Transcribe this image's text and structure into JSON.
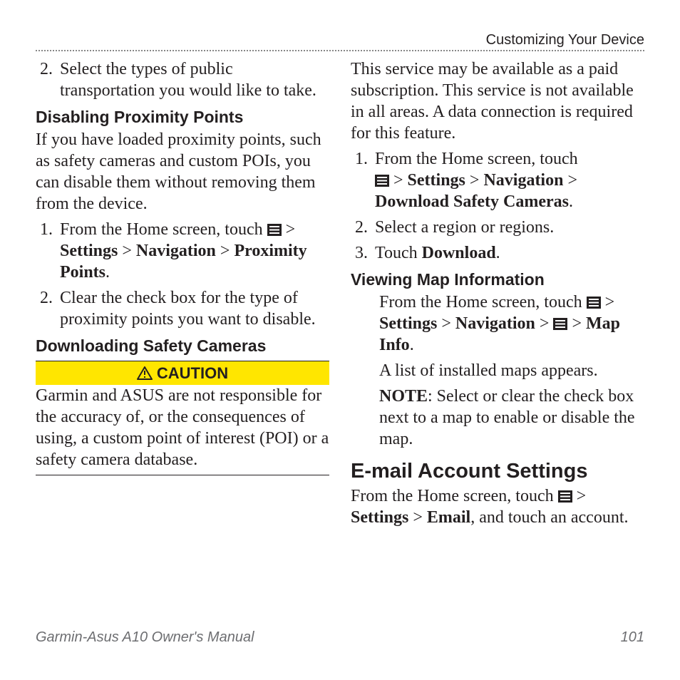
{
  "header": {
    "chapter": "Customizing Your Device"
  },
  "left": {
    "step2_pre": "Select the types of public transportation you would like to take.",
    "h_prox": "Disabling Proximity Points",
    "prox_intro": "If you have loaded proximity points, such as safety cameras and custom POIs, you can disable them without removing them from the device.",
    "prox_s1_a": "From the Home screen, touch ",
    "prox_s1_b": " > ",
    "prox_s1_settings": "Settings",
    "prox_s1_nav": "Navigation",
    "prox_s1_pp": "Proximity Points",
    "prox_s1_dot": ".",
    "prox_s2": "Clear the check box for the type of proximity points you want to disable.",
    "h_dl": "Downloading Safety Cameras",
    "caution": "CAUTION",
    "caution_body": "Garmin and ASUS are not responsible for the accuracy of, or the consequences of using, a custom point of interest (POI) or a safety camera database."
  },
  "right": {
    "intro": "This service may be available as a paid subscription. This service is not available in all areas. A data connection is required for this feature.",
    "s1_a": "From the Home screen, touch ",
    "s1_b": " > ",
    "s1_settings": "Settings",
    "s1_nav": "Navigation",
    "s1_dsc": "Download Safety Cameras",
    "s1_dot": ".",
    "s2": "Select a region or regions.",
    "s3_a": "Touch ",
    "s3_b": "Download",
    "s3_dot": ".",
    "h_map": "Viewing Map Information",
    "m_a": "From the Home screen, touch ",
    "m_b": " > ",
    "m_settings": "Settings",
    "m_nav": "Navigation",
    "m_map": "Map Info",
    "m_dot": ".",
    "m_list": "A list of installed maps appears.",
    "m_note_label": "NOTE",
    "m_note_body": ": Select or clear the check box next to a map to enable or disable the map.",
    "h_email": "E-mail Account Settings",
    "e_a": "From the Home screen, touch ",
    "e_b": " > ",
    "e_settings": "Settings",
    "e_email": "Email",
    "e_tail": ", and touch an account."
  },
  "footer": {
    "title": "Garmin-Asus A10 Owner's Manual",
    "page": "101"
  },
  "nums": {
    "n1": "1.",
    "n2": "2.",
    "n3": "3."
  },
  "sep": " > "
}
